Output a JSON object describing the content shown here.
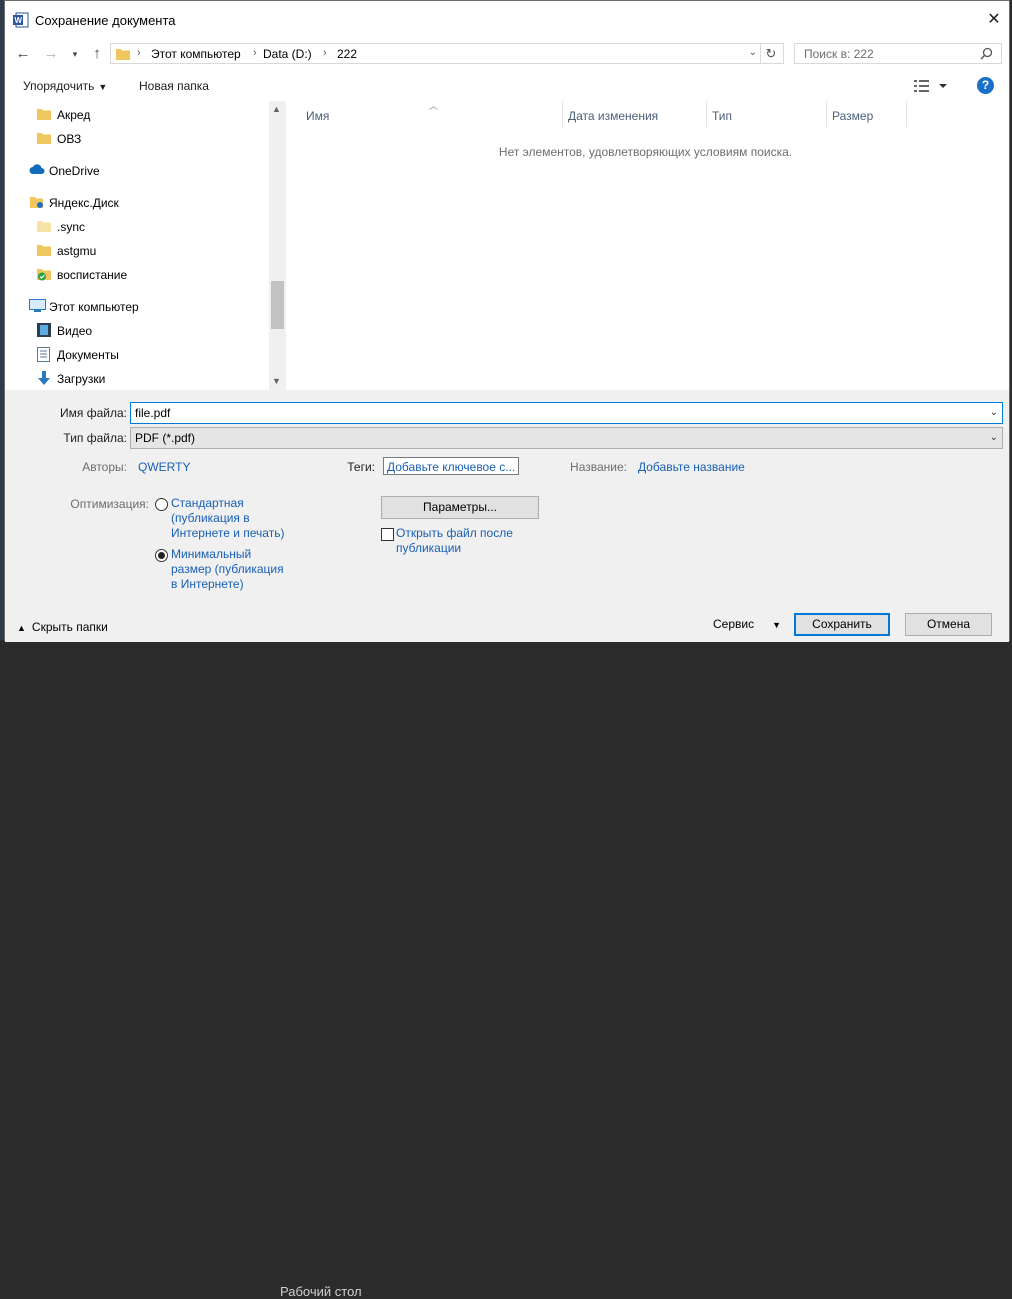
{
  "window": {
    "title": "Сохранение документа"
  },
  "address": {
    "segments": [
      "Этот компьютер",
      "Data (D:)",
      "222"
    ],
    "search_placeholder": "Поиск в: 222"
  },
  "toolbar": {
    "organize": "Упорядочить",
    "new_folder": "Новая папка"
  },
  "nav": {
    "items": [
      {
        "label": "Акред",
        "icon": "folder-icon"
      },
      {
        "label": "ОВЗ",
        "icon": "folder-icon"
      },
      {
        "label": "OneDrive",
        "icon": "cloud-icon"
      },
      {
        "label": "Яндекс.Диск",
        "icon": "yandex-disk-icon"
      },
      {
        "label": ".sync",
        "icon": "folder-icon"
      },
      {
        "label": "astgmu",
        "icon": "folder-icon"
      },
      {
        "label": "воспистание",
        "icon": "folder-synced-icon"
      },
      {
        "label": "Этот компьютер",
        "icon": "computer-icon"
      },
      {
        "label": "Видео",
        "icon": "video-icon"
      },
      {
        "label": "Документы",
        "icon": "documents-icon"
      },
      {
        "label": "Загрузки",
        "icon": "downloads-icon"
      }
    ]
  },
  "columns": [
    "Имя",
    "Дата изменения",
    "Тип",
    "Размер"
  ],
  "empty_message": "Нет элементов, удовлетворяющих условиям поиска.",
  "form": {
    "filename_label": "Имя файла:",
    "filename_value": "file.pdf",
    "filetype_label": "Тип файла:",
    "filetype_value": "PDF (*.pdf)",
    "authors_label": "Авторы:",
    "authors_value": "QWERTY",
    "tags_label": "Теги:",
    "tags_value": "Добавьте ключевое с...",
    "title_label": "Название:",
    "title_value": "Добавьте название",
    "optimize_label": "Оптимизация:",
    "opt_standard": [
      "Стандартная",
      "(публикация в",
      "Интернете и печать)"
    ],
    "opt_minimal": [
      "Минимальный",
      "размер (публикация",
      "в Интернете)"
    ],
    "params_button": "Параметры...",
    "open_after": [
      "Открыть файл после",
      "публикации"
    ]
  },
  "footer": {
    "hide_folders": "Скрыть папки",
    "service": "Сервис",
    "save": "Сохранить",
    "cancel": "Отмена"
  },
  "background": {
    "desktop_label": "Рабочий стол"
  }
}
